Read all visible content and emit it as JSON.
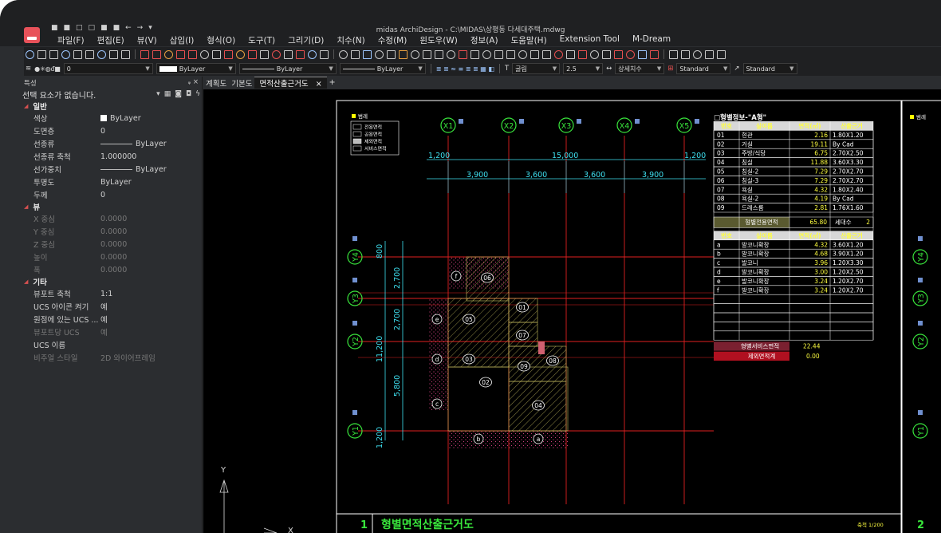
{
  "app": {
    "title": "midas ArchiDesign - C:\\MIDAS\\상평동 다세대주택.mdwg",
    "menu": [
      "파일(F)",
      "편집(E)",
      "뷰(V)",
      "삽입(I)",
      "형식(O)",
      "도구(T)",
      "그리기(D)",
      "치수(N)",
      "수정(M)",
      "윈도우(W)",
      "정보(A)",
      "도움말(H)",
      "Extension Tool",
      "M-Dream"
    ]
  },
  "toolbar2": {
    "layer": "0",
    "color": "ByLayer",
    "linetype": "ByLayer",
    "lineweight": "ByLayer",
    "text_style": "굴림",
    "text_height": "2.5",
    "dim_style": "상세치수",
    "table_style": "Standard",
    "multileader_style": "Standard"
  },
  "properties": {
    "title": "특성",
    "pin": "ᵩ ×",
    "selection": "선택 요소가 없습니다.",
    "sections": {
      "general": "일반",
      "view": "뷰",
      "misc": "기타"
    },
    "general": [
      {
        "key": "색상",
        "value": "ByLayer"
      },
      {
        "key": "도면층",
        "value": "0"
      },
      {
        "key": "선종류",
        "value": "ByLayer"
      },
      {
        "key": "선종류 축척",
        "value": "1.000000"
      },
      {
        "key": "선가중치",
        "value": "ByLayer"
      },
      {
        "key": "투명도",
        "value": "ByLayer"
      },
      {
        "key": "두께",
        "value": "0"
      }
    ],
    "view": [
      {
        "key": "X 중심",
        "value": "0.0000"
      },
      {
        "key": "Y 중심",
        "value": "0.0000"
      },
      {
        "key": "Z 중심",
        "value": "0.0000"
      },
      {
        "key": "높이",
        "value": "0.0000"
      },
      {
        "key": "폭",
        "value": "0.0000"
      }
    ],
    "misc": [
      {
        "key": "뷰포트 축척",
        "value": "1:1"
      },
      {
        "key": "UCS 아이콘 켜기",
        "value": "예"
      },
      {
        "key": "원점에 있는 UCS ...",
        "value": "예"
      },
      {
        "key": "뷰포트당 UCS",
        "value": "예"
      },
      {
        "key": "UCS 이름",
        "value": ""
      },
      {
        "key": "비주얼 스타일",
        "value": "2D 와이어프레임"
      }
    ]
  },
  "tabs": [
    "계획도",
    "기본도",
    "면적산출근거도",
    "×",
    "+"
  ],
  "drawing": {
    "legend": {
      "title": "범례",
      "items": [
        "전용면적",
        "공용면적",
        "제외면적",
        "서비스면적"
      ]
    },
    "grid_x": [
      "X1",
      "X2",
      "X3",
      "X4",
      "X5"
    ],
    "grid_y": [
      "Y1",
      "Y2",
      "Y3",
      "Y4"
    ],
    "dims_top_overall": [
      "1,200",
      "15,000",
      "1,200"
    ],
    "dims_top": [
      "3,900",
      "3,600",
      "3,600",
      "3,900"
    ],
    "dims_left": [
      "800",
      "2,700",
      "2,700",
      "5,800",
      "11,200",
      "1,200"
    ],
    "room_tags": [
      "01",
      "02",
      "03",
      "04",
      "05",
      "06",
      "07",
      "08",
      "09",
      "a",
      "b",
      "c",
      "d",
      "e",
      "f"
    ],
    "table_title": "형별정보-\"A형\"",
    "table_headers": [
      "번호",
      "실이름",
      "면적(㎡)",
      "산출근거"
    ],
    "rooms": [
      [
        "01",
        "현관",
        "2.16",
        "1.80X1.20"
      ],
      [
        "02",
        "거실",
        "19.11",
        "By Cad"
      ],
      [
        "03",
        "주방/식당",
        "6.75",
        "2.70X2.50"
      ],
      [
        "04",
        "침실",
        "11.88",
        "3.60X3.30"
      ],
      [
        "05",
        "침실-2",
        "7.29",
        "2.70X2.70"
      ],
      [
        "06",
        "침실-3",
        "7.29",
        "2.70X2.70"
      ],
      [
        "07",
        "욕실",
        "4.32",
        "1.80X2.40"
      ],
      [
        "08",
        "욕실-2",
        "4.19",
        "By Cad"
      ],
      [
        "09",
        "드레스룸",
        "2.81",
        "1.76X1.60"
      ]
    ],
    "exclusive_label": "형별전용면적",
    "exclusive_value": "65.80",
    "households_label": "세대수",
    "households_value": "2",
    "service_rows": [
      [
        "a",
        "발코니확장",
        "4.32",
        "3.60X1.20"
      ],
      [
        "b",
        "발코니확장",
        "4.68",
        "3.90X1.20"
      ],
      [
        "c",
        "발코니",
        "3.96",
        "1.20X3.30"
      ],
      [
        "d",
        "발코니확장",
        "3.00",
        "1.20X2.50"
      ],
      [
        "e",
        "발코니확장",
        "3.24",
        "1.20X2.70"
      ],
      [
        "f",
        "발코니확장",
        "3.24",
        "1.20X2.70"
      ]
    ],
    "service_label": "형별서비스면적",
    "service_value": "22.44",
    "excluded_label": "제외면적계",
    "excluded_value": "0.00",
    "title_no": "1",
    "title": "형별면적산출근거도",
    "scale": "축척 1/200",
    "next_no": "2",
    "ucs_y": "Y",
    "ucs_x": "X"
  }
}
